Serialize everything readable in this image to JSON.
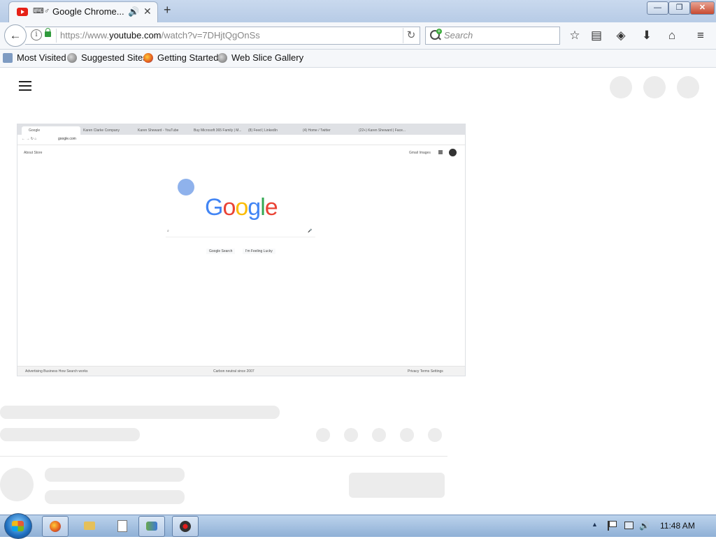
{
  "browser": {
    "tab": {
      "keyboard_glyph": "⌨♂",
      "title": "Google Chrome...",
      "audio_icon": "speaker-icon",
      "close": "✕"
    },
    "new_tab": "+",
    "window_controls": {
      "minimize": "—",
      "maximize": "❐",
      "close": "✕"
    },
    "nav": {
      "back": "←",
      "url_scheme": "https://www.",
      "url_host": "youtube.com",
      "url_rest": "/watch?v=7DHjtQgOnSs",
      "reload": "↻",
      "search_placeholder": "Search"
    },
    "toolbar_icons": {
      "star": "☆",
      "reader": "▤",
      "pocket": "◈",
      "download": "⬇",
      "home": "⌂",
      "menu": "≡"
    },
    "bookmarks": [
      "Most Visited",
      "Suggested Sites",
      "Getting Started",
      "Web Slice Gallery"
    ]
  },
  "video": {
    "chrome_tabs": [
      "Google",
      "Karen Clarke Company",
      "Karen Sheward - YouTube",
      "Buy Microsoft 365 Family | M...",
      "(8) Feed | LinkedIn",
      "(4) Home / Twitter",
      "(22+) Karen Sheward | Face..."
    ],
    "chrome_url": "google.com",
    "top_links": {
      "left": "About   Store",
      "right": "Gmail   Images"
    },
    "logo": [
      "G",
      "o",
      "o",
      "g",
      "l",
      "e"
    ],
    "buttons": [
      "Google Search",
      "I'm Feeling Lucky"
    ],
    "footer_left": "Advertising     Business     How Search works",
    "footer_mid": "Carbon neutral since 2007",
    "footer_right": "Privacy     Terms     Settings"
  },
  "taskbar": {
    "clock": "11:48 AM",
    "tray_arrow": "▲",
    "volume": "🔊"
  },
  "colors": {
    "google_blue": "#4285f4",
    "google_red": "#ea4335",
    "google_yellow": "#fbbc05",
    "google_green": "#34a853",
    "youtube_red": "#e62117"
  }
}
